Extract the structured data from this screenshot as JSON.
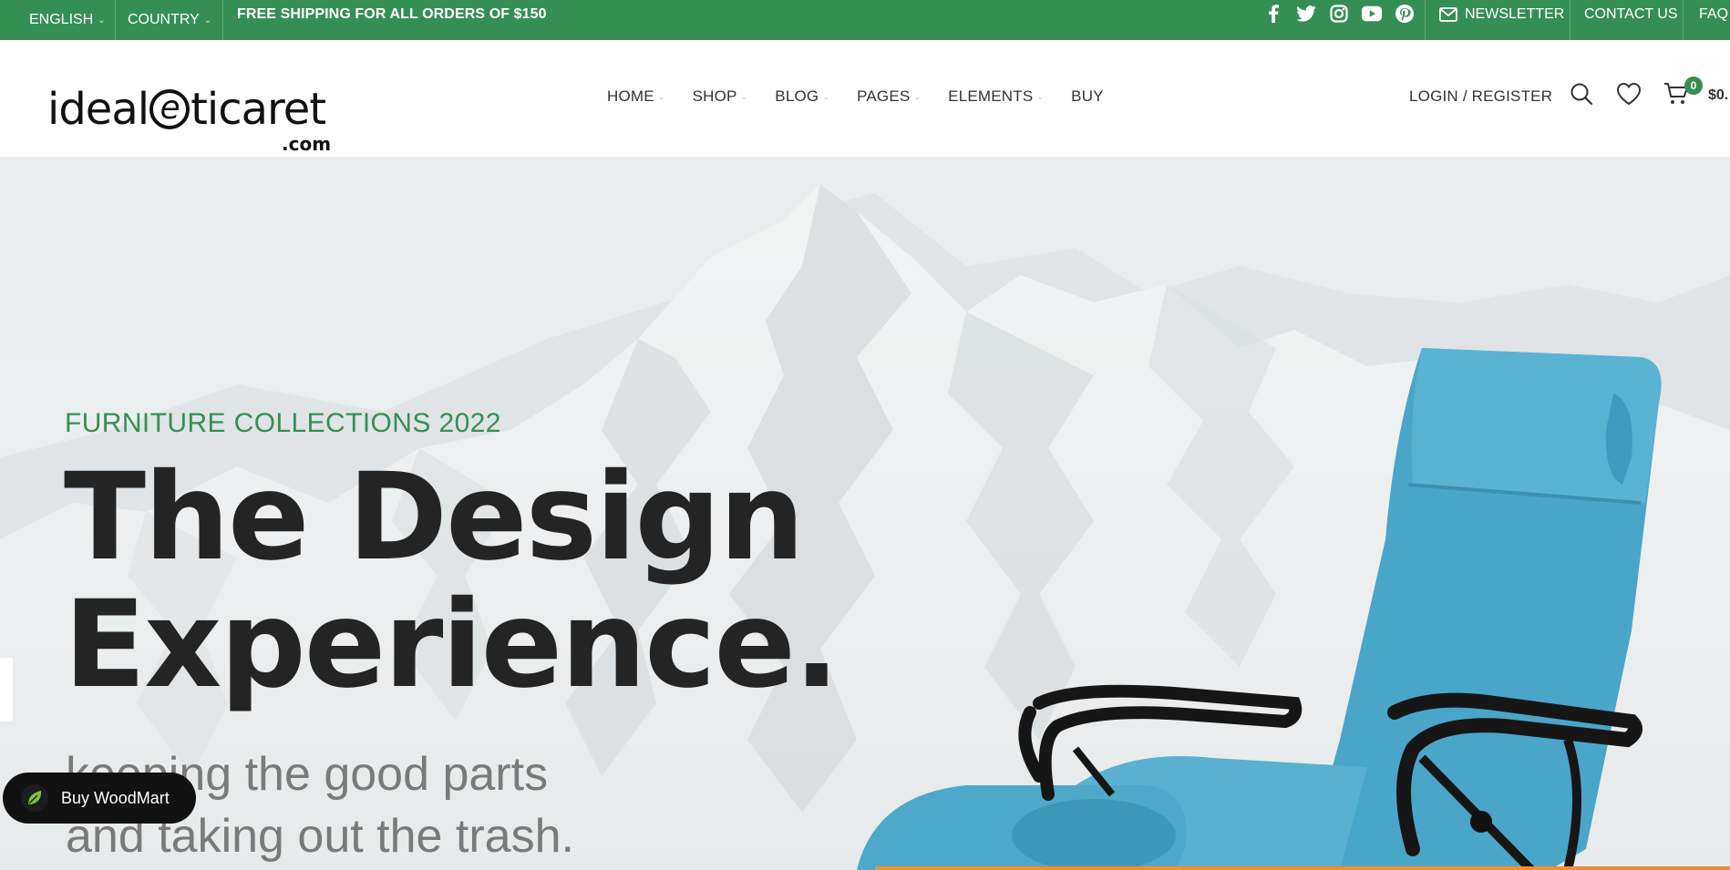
{
  "topbar": {
    "language": "ENGLISH",
    "country": "COUNTRY",
    "shipping_text": "FREE SHIPPING FOR ALL ORDERS OF $150",
    "social_icons": [
      "facebook-icon",
      "twitter-icon",
      "instagram-icon",
      "youtube-icon",
      "pinterest-icon"
    ],
    "newsletter": "NEWSLETTER",
    "contact": "CONTACT US",
    "faq": "FAQ"
  },
  "header": {
    "logo_main": "ideal",
    "logo_e": "e",
    "logo_tail": "ticaret",
    "logo_com": ".com",
    "nav": [
      {
        "label": "HOME",
        "has_dropdown": true
      },
      {
        "label": "SHOP",
        "has_dropdown": true
      },
      {
        "label": "BLOG",
        "has_dropdown": true
      },
      {
        "label": "PAGES",
        "has_dropdown": true
      },
      {
        "label": "ELEMENTS",
        "has_dropdown": true
      },
      {
        "label": "BUY",
        "has_dropdown": false
      }
    ],
    "login": "LOGIN / REGISTER",
    "cart_count": "0",
    "cart_price": "$0."
  },
  "hero": {
    "eyebrow": "FURNITURE COLLECTIONS 2022",
    "headline_line1": "The Design",
    "headline_line2": "Experience.",
    "sub_line1": "keeping the good parts",
    "sub_line2": "and taking out the trash."
  },
  "floating": {
    "buy_label": "Buy WoodMart"
  },
  "colors": {
    "brand_green": "#358f55",
    "headline": "#242424",
    "chair_blue": "#4aa6c9"
  }
}
